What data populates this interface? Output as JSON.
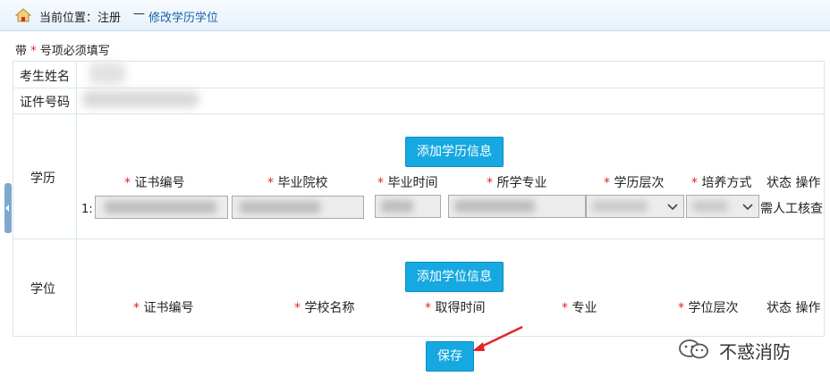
{
  "breadcrumb": {
    "label": "当前位置：注册",
    "separator": "—",
    "current": "修改学历学位"
  },
  "required_note": {
    "prefix": "带",
    "star": "*",
    "suffix": "号项必须填写"
  },
  "fields": {
    "name_label": "考生姓名",
    "id_label": "证件号码"
  },
  "education": {
    "section_label": "学历",
    "add_button": "添加学历信息",
    "columns": [
      "证书编号",
      "毕业院校",
      "毕业时间",
      "所学专业",
      "学历层次",
      "培养方式"
    ],
    "status_header": "状态 操作",
    "row": {
      "index": "1:",
      "status": "需人工核查"
    }
  },
  "degree": {
    "section_label": "学位",
    "add_button": "添加学位信息",
    "columns": [
      "证书编号",
      "学校名称",
      "取得时间",
      "专业",
      "学位层次"
    ],
    "status_header": "状态 操作"
  },
  "save_button": "保存",
  "watermark": "不惑消防",
  "colors": {
    "accent_button": "#16a8e1",
    "required_star": "#e4242b",
    "breadcrumb_link": "#1a5fa8",
    "annotation_arrow": "#e4242b"
  }
}
